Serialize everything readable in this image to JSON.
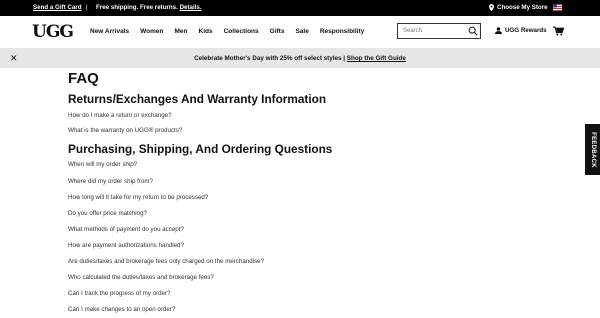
{
  "topbar": {
    "gift_card": "Send a Gift Card",
    "separator": "|",
    "shipping": "Free shipping. Free returns.",
    "details": "Details.",
    "store": "Choose My Store",
    "flag_icon": "us-flag-icon"
  },
  "nav": {
    "logo": "UGG",
    "items": [
      "New Arrivals",
      "Women",
      "Men",
      "Kids",
      "Collections",
      "Gifts",
      "Sale",
      "Responsibility"
    ],
    "search_placeholder": "Search",
    "rewards": "UGG Rewards"
  },
  "promo": {
    "close": "✕",
    "text": "Celebrate Mother's Day with 25% off select styles | ",
    "link": "Shop the Gift Guide"
  },
  "main": {
    "title": "FAQ",
    "sections": [
      {
        "title": "Returns/Exchanges And Warranty Information",
        "questions": [
          "How do I make a return or exchange?",
          "What is the warranty on UGG® products?"
        ]
      },
      {
        "title": "Purchasing, Shipping, And Ordering Questions",
        "questions": [
          "When will my order ship?",
          "Where did my order ship from?",
          "How long will it take for my return to be processed?",
          "Do you offer price matching?",
          "What methods of payment do you accept?",
          "How are payment authorizations handled?",
          "Are duties/taxes and brokerage fees only charged on the merchandise?",
          "Who calculated the duties/taxes and brokerage fees?",
          "Can I track the progress of my order?",
          "Can I make changes to an open order?"
        ]
      }
    ]
  },
  "feedback": "FEEDBACK",
  "colors": {
    "topbar_bg": "#000000",
    "promo_bg": "#e6e6e6",
    "text": "#111111"
  }
}
